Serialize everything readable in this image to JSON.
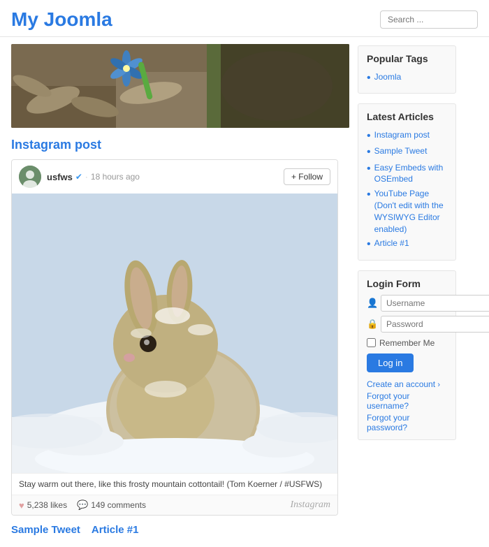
{
  "header": {
    "site_title": "My Joomla",
    "search_placeholder": "Search ..."
  },
  "hero": {
    "alt": "Nature header image"
  },
  "instagram_section": {
    "title": "Instagram post",
    "username": "usfws",
    "verified": true,
    "time_ago": "18 hours ago",
    "follow_label": "+ Follow",
    "caption": "Stay warm out there, like this frosty mountain cottontail! (Tom Koerner / #USFWS)",
    "likes": "5,238 likes",
    "comments": "149 comments",
    "brand": "Instagram"
  },
  "bottom_links": [
    {
      "label": "Sample Tweet",
      "href": "#"
    },
    {
      "label": "Article #1",
      "href": "#"
    }
  ],
  "sidebar": {
    "popular_tags": {
      "title": "Popular Tags",
      "tags": [
        {
          "label": "Joomla",
          "href": "#"
        }
      ]
    },
    "latest_articles": {
      "title": "Latest Articles",
      "articles": [
        {
          "label": "Instagram post",
          "href": "#"
        },
        {
          "label": "Sample Tweet",
          "href": "#"
        },
        {
          "label": "Easy Embeds with OSEmbed",
          "href": "#"
        },
        {
          "label": "YouTube Page (Don't edit with the WYSIWYG Editor enabled)",
          "href": "#"
        },
        {
          "label": "Article #1",
          "href": "#"
        }
      ]
    },
    "login_form": {
      "title": "Login Form",
      "username_placeholder": "Username",
      "password_placeholder": "Password",
      "remember_label": "Remember Me",
      "login_button": "Log in",
      "create_account": "Create an account",
      "forgot_username": "Forgot your username?",
      "forgot_password": "Forgot your password?"
    }
  }
}
